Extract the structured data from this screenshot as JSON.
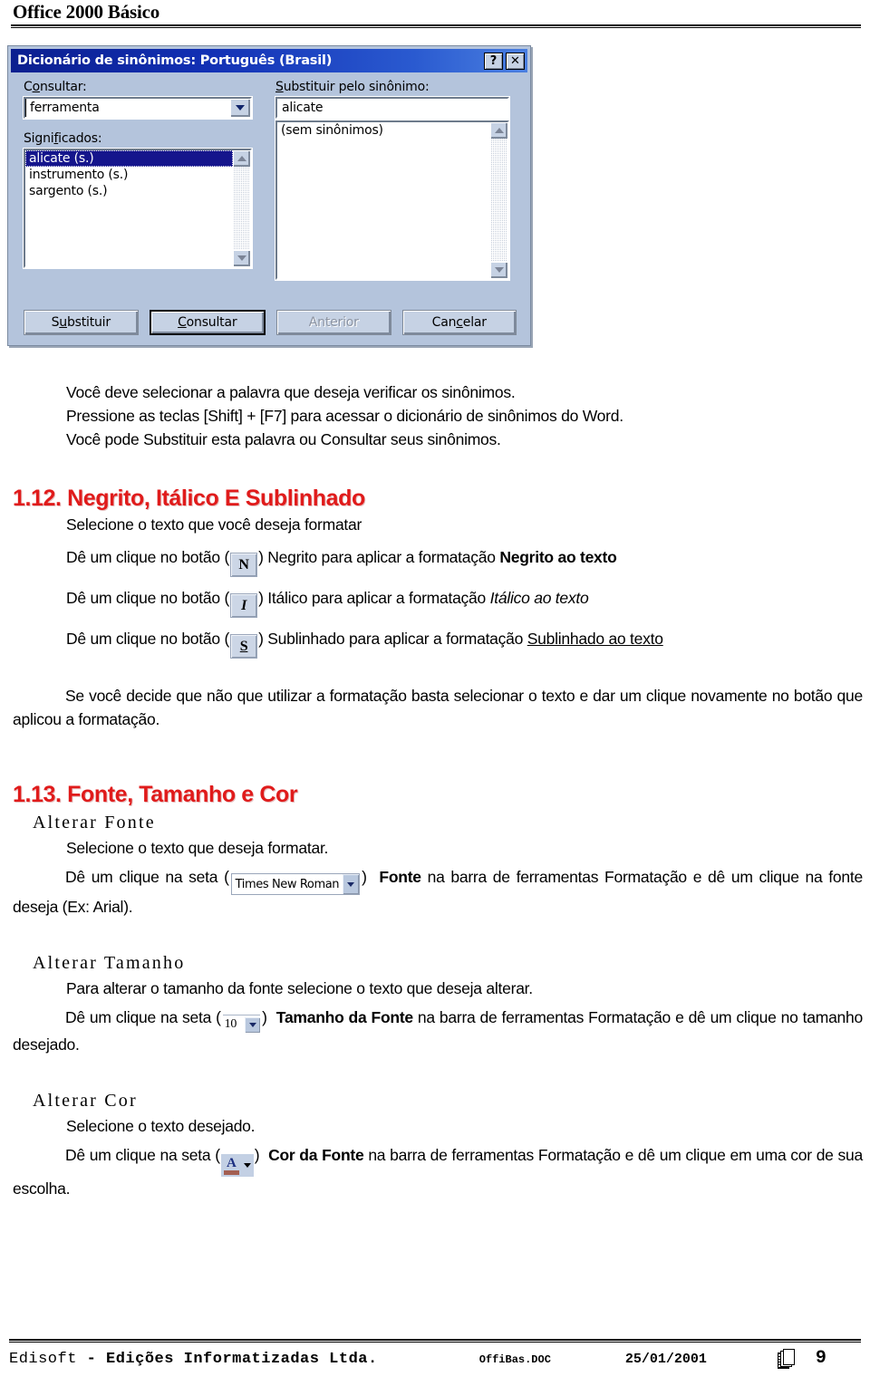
{
  "header": {
    "title": "Office 2000 Básico"
  },
  "dialog": {
    "title": "Dicionário de sinônimos: Português (Brasil)",
    "help_button": "?",
    "close_button": "✕",
    "consultar_label": "Consultar:",
    "consultar_value": "ferramenta",
    "substituir_label": "Substituir pelo sinônimo:",
    "substituir_value": "alicate",
    "significados_label": "Significados:",
    "meanings": [
      "alicate (s.)",
      "instrumento (s.)",
      "sargento (s.)"
    ],
    "synonyms": [
      "(sem sinônimos)"
    ],
    "buttons": {
      "substituir": "Substituir",
      "consultar": "Consultar",
      "anterior": "Anterior",
      "cancelar": "Cancelar"
    }
  },
  "intro": {
    "line1": "Você deve selecionar a palavra que deseja verificar os sinônimos.",
    "line2": "Pressione as teclas [Shift] + [F7] para acessar o dicionário de sinônimos do Word.",
    "line3": "Você pode Substituir esta palavra ou Consultar seus sinônimos."
  },
  "section_112": {
    "heading": "1.12. Negrito, Itálico E Sublinhado",
    "intro": "Selecione o texto que você deseja formatar",
    "bold_line": {
      "prefix": "Dê um clique no botão (",
      "icon_label": "N",
      "middle": ") Negrito para aplicar a formatação ",
      "emphasis": "Negrito ao texto"
    },
    "italic_line": {
      "prefix": "Dê um clique no botão (",
      "icon_label": "I",
      "middle": ") Itálico para aplicar a formatação ",
      "emphasis": "Itálico ao texto"
    },
    "underline_line": {
      "prefix": "Dê um clique no botão (",
      "icon_label": "S",
      "middle": ") Sublinhado para aplicar a formatação ",
      "emphasis": "Sublinhado ao texto"
    },
    "note": "Se você decide que não que utilizar a formatação basta selecionar o texto e dar um clique novamente no botão que aplicou a formatação."
  },
  "section_113": {
    "heading": "1.13. Fonte, Tamanho e Cor",
    "fonte": {
      "sub_heading": "Alterar Fonte",
      "line1": "Selecione o texto que deseja formatar.",
      "prefix": "Dê um clique na seta (",
      "combo_value": "Times New Roman",
      "close_paren": ")",
      "bold_term": "Fonte",
      "suffix": " na barra de ferramentas Formatação e dê um clique na fonte deseja (Ex: Arial)."
    },
    "tamanho": {
      "sub_heading": "Alterar Tamanho",
      "line1": "Para alterar o tamanho da fonte selecione o texto que deseja alterar.",
      "prefix": "Dê um clique na seta (",
      "size_value": "10",
      "close_paren": ")",
      "bold_term": "Tamanho da Fonte",
      "suffix": " na barra de ferramentas Formatação e dê um clique no tamanho desejado."
    },
    "cor": {
      "sub_heading": "Alterar Cor",
      "line1": "Selecione o texto desejado.",
      "prefix": "Dê um clique na seta (",
      "icon_letter": "A",
      "close_paren": ")",
      "bold_term": "Cor da Fonte",
      "suffix": " na barra de ferramentas Formatação e dê um clique em uma cor de sua escolha."
    }
  },
  "footer": {
    "company_prefix": "Edisoft ",
    "company_rest": "- Edições Informatizadas Ltda.",
    "doc_name": "OffiBas.DOC",
    "date": "25/01/2001",
    "page_number": "9"
  },
  "colors": {
    "heading_red": "#e01b1b",
    "title_bar_blue": "#0b1f8f",
    "dialog_face": "#b4c4dc",
    "selection_blue": "#15158c",
    "font_color_letter": "#1c2f80",
    "font_color_bar": "#a35f52"
  }
}
